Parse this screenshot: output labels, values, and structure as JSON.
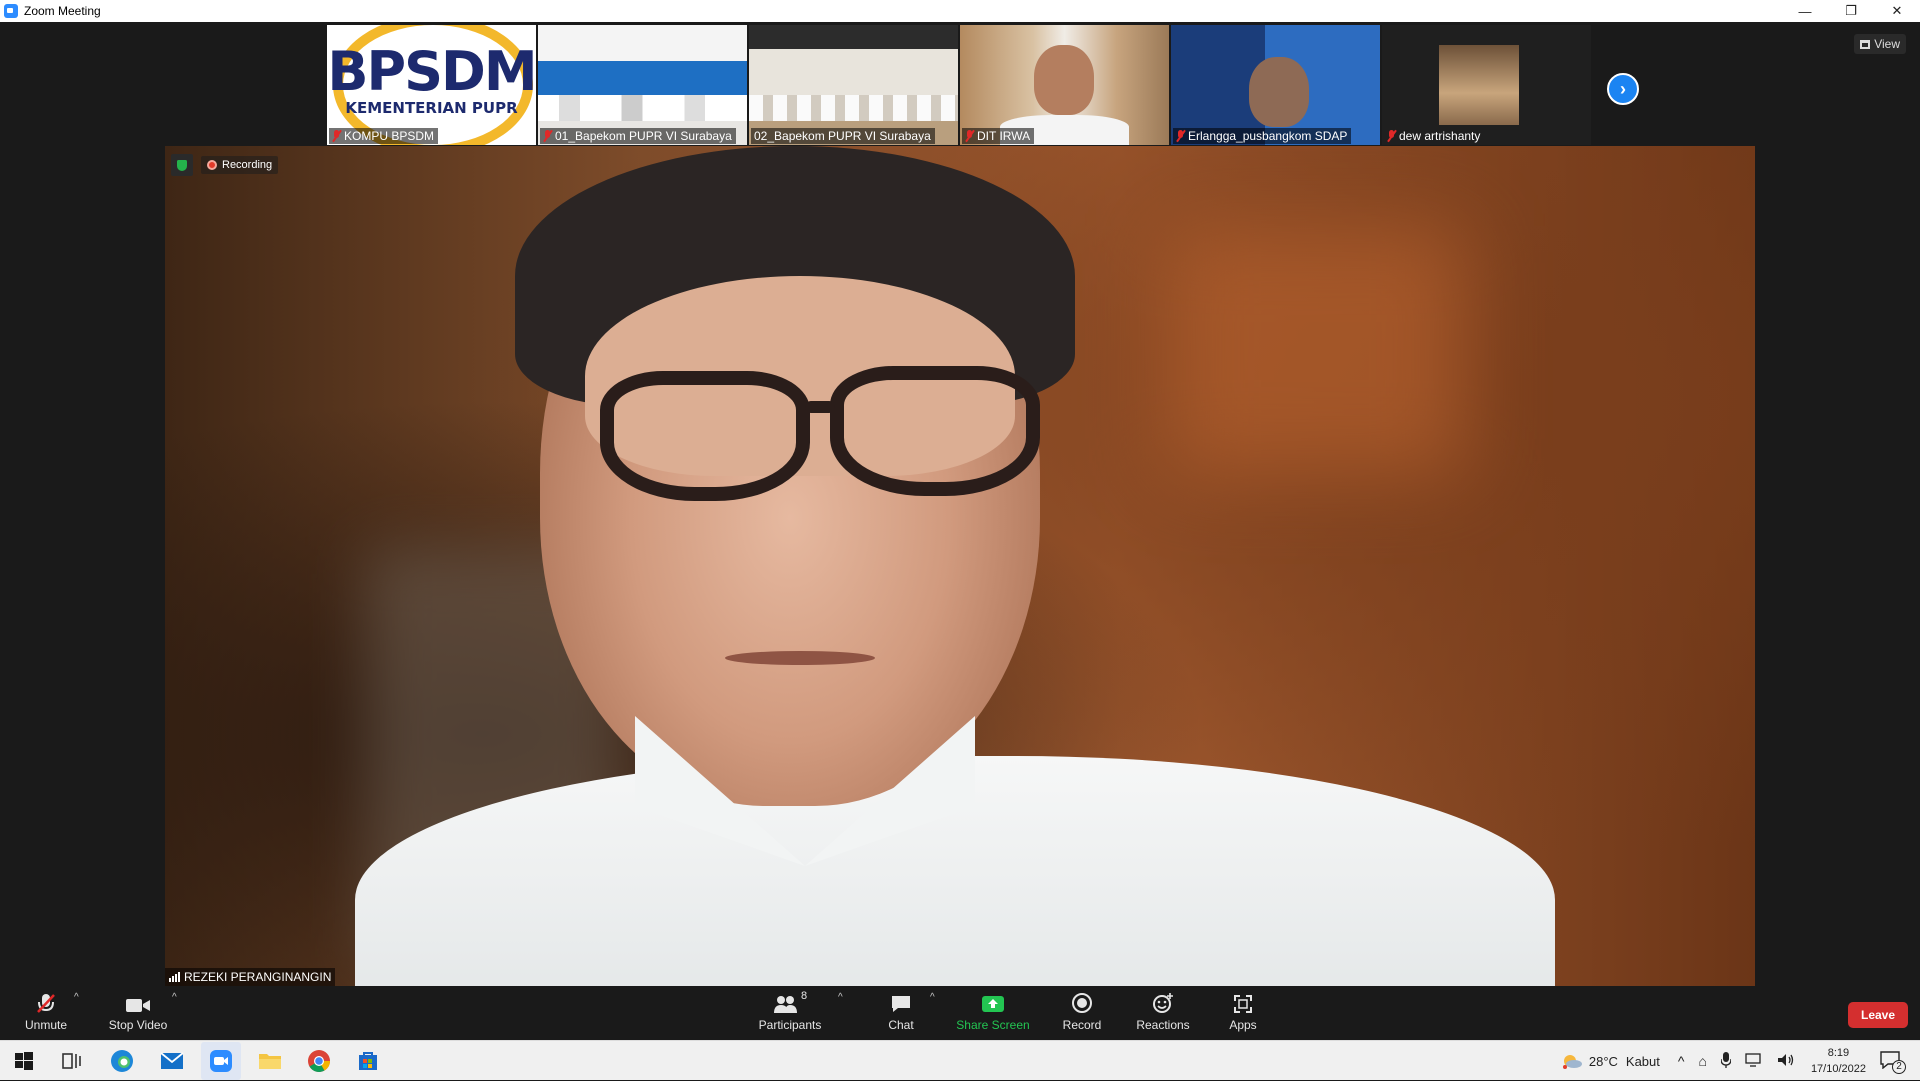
{
  "window": {
    "title": "Zoom Meeting",
    "controls": [
      "—",
      "❐",
      "✕"
    ]
  },
  "thumbnails": [
    {
      "name": "KOMPU BPSDM",
      "muted": true,
      "logo_main": "BPSDM",
      "logo_sub": "KEMENTERIAN PUPR"
    },
    {
      "name": "01_Bapekom PUPR VI Surabaya",
      "muted": true
    },
    {
      "name": "02_Bapekom PUPR VI Surabaya",
      "muted": false
    },
    {
      "name": "DIT IRWA",
      "muted": true
    },
    {
      "name": "Erlangga_pusbangkom SDAP",
      "muted": true
    },
    {
      "name": "dew artrishanty",
      "muted": true
    }
  ],
  "view_button": "View",
  "main_video": {
    "recording_label": "Recording",
    "speaker_name": "REZEKI PERANGINANGIN"
  },
  "toolbar": {
    "unmute": "Unmute",
    "stop_video": "Stop Video",
    "participants": "Participants",
    "participant_count": "8",
    "chat": "Chat",
    "share_screen": "Share Screen",
    "record": "Record",
    "reactions": "Reactions",
    "apps": "Apps",
    "leave": "Leave"
  },
  "taskbar": {
    "weather_temp": "28°C",
    "weather_desc": "Kabut",
    "time": "8:19",
    "date": "17/10/2022",
    "notification_count": "2"
  },
  "colors": {
    "accent": "#2d8cff",
    "leave": "#d42f2f",
    "share": "#23c552",
    "muted": "#e02828"
  }
}
